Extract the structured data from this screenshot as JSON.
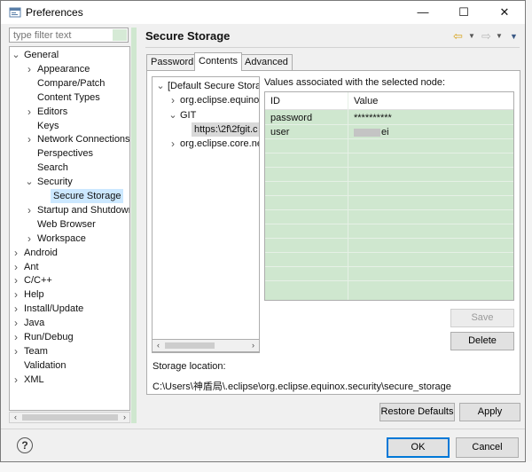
{
  "window": {
    "title": "Preferences",
    "controls": {
      "minimize": "—",
      "maximize": "☐",
      "close": "✕"
    }
  },
  "filter": {
    "placeholder": "type filter text"
  },
  "tree": {
    "items": [
      {
        "label": "General",
        "indent": 0,
        "twisty": "v"
      },
      {
        "label": "Appearance",
        "indent": 1,
        "twisty": ">"
      },
      {
        "label": "Compare/Patch",
        "indent": 1,
        "twisty": ""
      },
      {
        "label": "Content Types",
        "indent": 1,
        "twisty": ""
      },
      {
        "label": "Editors",
        "indent": 1,
        "twisty": ">"
      },
      {
        "label": "Keys",
        "indent": 1,
        "twisty": ""
      },
      {
        "label": "Network Connections",
        "indent": 1,
        "twisty": ">"
      },
      {
        "label": "Perspectives",
        "indent": 1,
        "twisty": ""
      },
      {
        "label": "Search",
        "indent": 1,
        "twisty": ""
      },
      {
        "label": "Security",
        "indent": 1,
        "twisty": "v"
      },
      {
        "label": "Secure Storage",
        "indent": 2,
        "twisty": "",
        "selected": true
      },
      {
        "label": "Startup and Shutdown",
        "indent": 1,
        "twisty": ">"
      },
      {
        "label": "Web Browser",
        "indent": 1,
        "twisty": ""
      },
      {
        "label": "Workspace",
        "indent": 1,
        "twisty": ">"
      },
      {
        "label": "Android",
        "indent": 0,
        "twisty": ">"
      },
      {
        "label": "Ant",
        "indent": 0,
        "twisty": ">"
      },
      {
        "label": "C/C++",
        "indent": 0,
        "twisty": ">"
      },
      {
        "label": "Help",
        "indent": 0,
        "twisty": ">"
      },
      {
        "label": "Install/Update",
        "indent": 0,
        "twisty": ">"
      },
      {
        "label": "Java",
        "indent": 0,
        "twisty": ">"
      },
      {
        "label": "Run/Debug",
        "indent": 0,
        "twisty": ">"
      },
      {
        "label": "Team",
        "indent": 0,
        "twisty": ">"
      },
      {
        "label": "Validation",
        "indent": 0,
        "twisty": ""
      },
      {
        "label": "XML",
        "indent": 0,
        "twisty": ">"
      }
    ]
  },
  "page": {
    "title": "Secure Storage",
    "tabs": [
      {
        "label": "Password",
        "active": false
      },
      {
        "label": "Contents",
        "active": true
      },
      {
        "label": "Advanced",
        "active": false
      }
    ],
    "node_tree": [
      {
        "label": "[Default Secure Storage]",
        "indent": 0,
        "twisty": "v"
      },
      {
        "label": "org.eclipse.equinox",
        "indent": 1,
        "twisty": ">"
      },
      {
        "label": "GIT",
        "indent": 1,
        "twisty": "v"
      },
      {
        "label": "https:\\2f\\2fgit.c",
        "indent": 2,
        "twisty": "",
        "selected": true
      },
      {
        "label": "org.eclipse.core.net",
        "indent": 1,
        "twisty": ">"
      }
    ],
    "values_label": "Values associated with the selected node:",
    "table": {
      "columns": [
        "ID",
        "Value"
      ],
      "rows": [
        {
          "id": "password",
          "value": "**********"
        },
        {
          "id": "user",
          "value": "ei"
        }
      ]
    },
    "buttons": {
      "save": "Save",
      "delete": "Delete"
    },
    "storage_location_label": "Storage location:",
    "storage_location_path": "C:\\Users\\神盾局\\.eclipse\\org.eclipse.equinox.security\\secure_storage",
    "restore_defaults": "Restore Defaults",
    "apply": "Apply"
  },
  "footer": {
    "help": "?",
    "ok": "OK",
    "cancel": "Cancel"
  },
  "colors": {
    "selection": "#cce8ff",
    "highlight_green": "#cfe7cf",
    "accent": "#0078d7"
  },
  "icons": [
    "preferences-app-icon",
    "back-arrow-icon",
    "forward-arrow-icon",
    "view-menu-icon",
    "help-icon"
  ]
}
